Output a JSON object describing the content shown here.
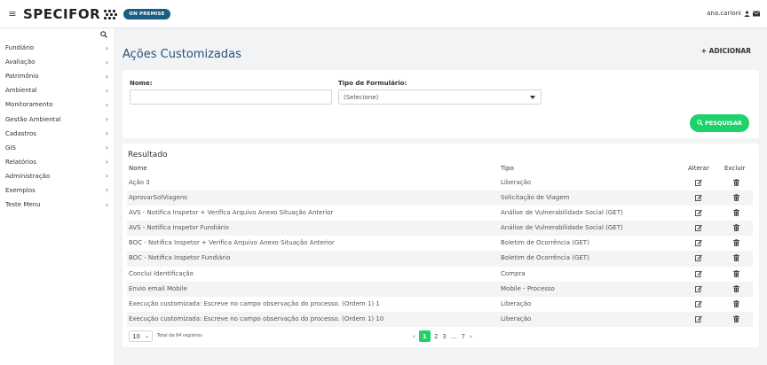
{
  "app": {
    "hamburger": "≡",
    "logo": "SPECIFOR",
    "badge": "ON PREMISE",
    "user": "ana.carioni"
  },
  "sidebar": {
    "items": [
      {
        "label": "Fundiário"
      },
      {
        "label": "Avaliação"
      },
      {
        "label": "Patrimônio"
      },
      {
        "label": "Ambiental"
      },
      {
        "label": "Monitoramento"
      },
      {
        "label": "Gestão Ambiental"
      },
      {
        "label": "Cadastros"
      },
      {
        "label": "GIS"
      },
      {
        "label": "Relatórios"
      },
      {
        "label": "Administração"
      },
      {
        "label": "Exemplos"
      },
      {
        "label": "Teste Menu"
      }
    ],
    "chevron": "›"
  },
  "page": {
    "title": "Ações Customizadas",
    "add_label": "+ ADICIONAR"
  },
  "filters": {
    "nome_label": "Nome:",
    "nome_value": "",
    "tipo_label": "Tipo de Formulário:",
    "tipo_value": "(Selecione)",
    "search_label": "PESQUISAR"
  },
  "result": {
    "title": "Resultado",
    "columns": {
      "name": "Nome",
      "tipo": "Tipo",
      "alterar": "Alterar",
      "excluir": "Excluir"
    },
    "rows": [
      {
        "name": "Ação 3",
        "tipo": "Liberação"
      },
      {
        "name": "AprovarSolViagens",
        "tipo": "Solicitação de Viagem"
      },
      {
        "name": "AVS - Notifica Inspetor + Verifica Arquivo Anexo Situação Anterior",
        "tipo": "Análise de Vulnerabilidade Social (GET)"
      },
      {
        "name": "AVS - Notifica Inspetor Fundiário",
        "tipo": "Análise de Vulnerabilidade Social (GET)"
      },
      {
        "name": "BOC - Notifica Inspetor + Verifica Arquivo Anexo Situação Anterior",
        "tipo": "Boletim de Ocorrência (GET)"
      },
      {
        "name": "BOC - Notifica Inspetor Fundiário",
        "tipo": "Boletim de Ocorrência (GET)"
      },
      {
        "name": "Conclui Identificação",
        "tipo": "Compra"
      },
      {
        "name": "Envio email Mobile",
        "tipo": "Mobile - Processo"
      },
      {
        "name": "Execução customizada: Escreve no campo observação do processo. (Ordem 1) 1",
        "tipo": "Liberação"
      },
      {
        "name": "Execução customizada: Escreve no campo observação do processo. (Ordem 1) 10",
        "tipo": "Liberação"
      }
    ]
  },
  "pagination": {
    "page_size": "10",
    "total_text": "Total de 64 registros",
    "prev": "‹",
    "current": "1",
    "p2": "2",
    "p3": "3",
    "ellipsis": "...",
    "last": "7",
    "next": "›"
  },
  "colors": {
    "accent_green": "#1ed26a",
    "title_blue": "#23527c",
    "badge_blue": "#1b5e83"
  }
}
